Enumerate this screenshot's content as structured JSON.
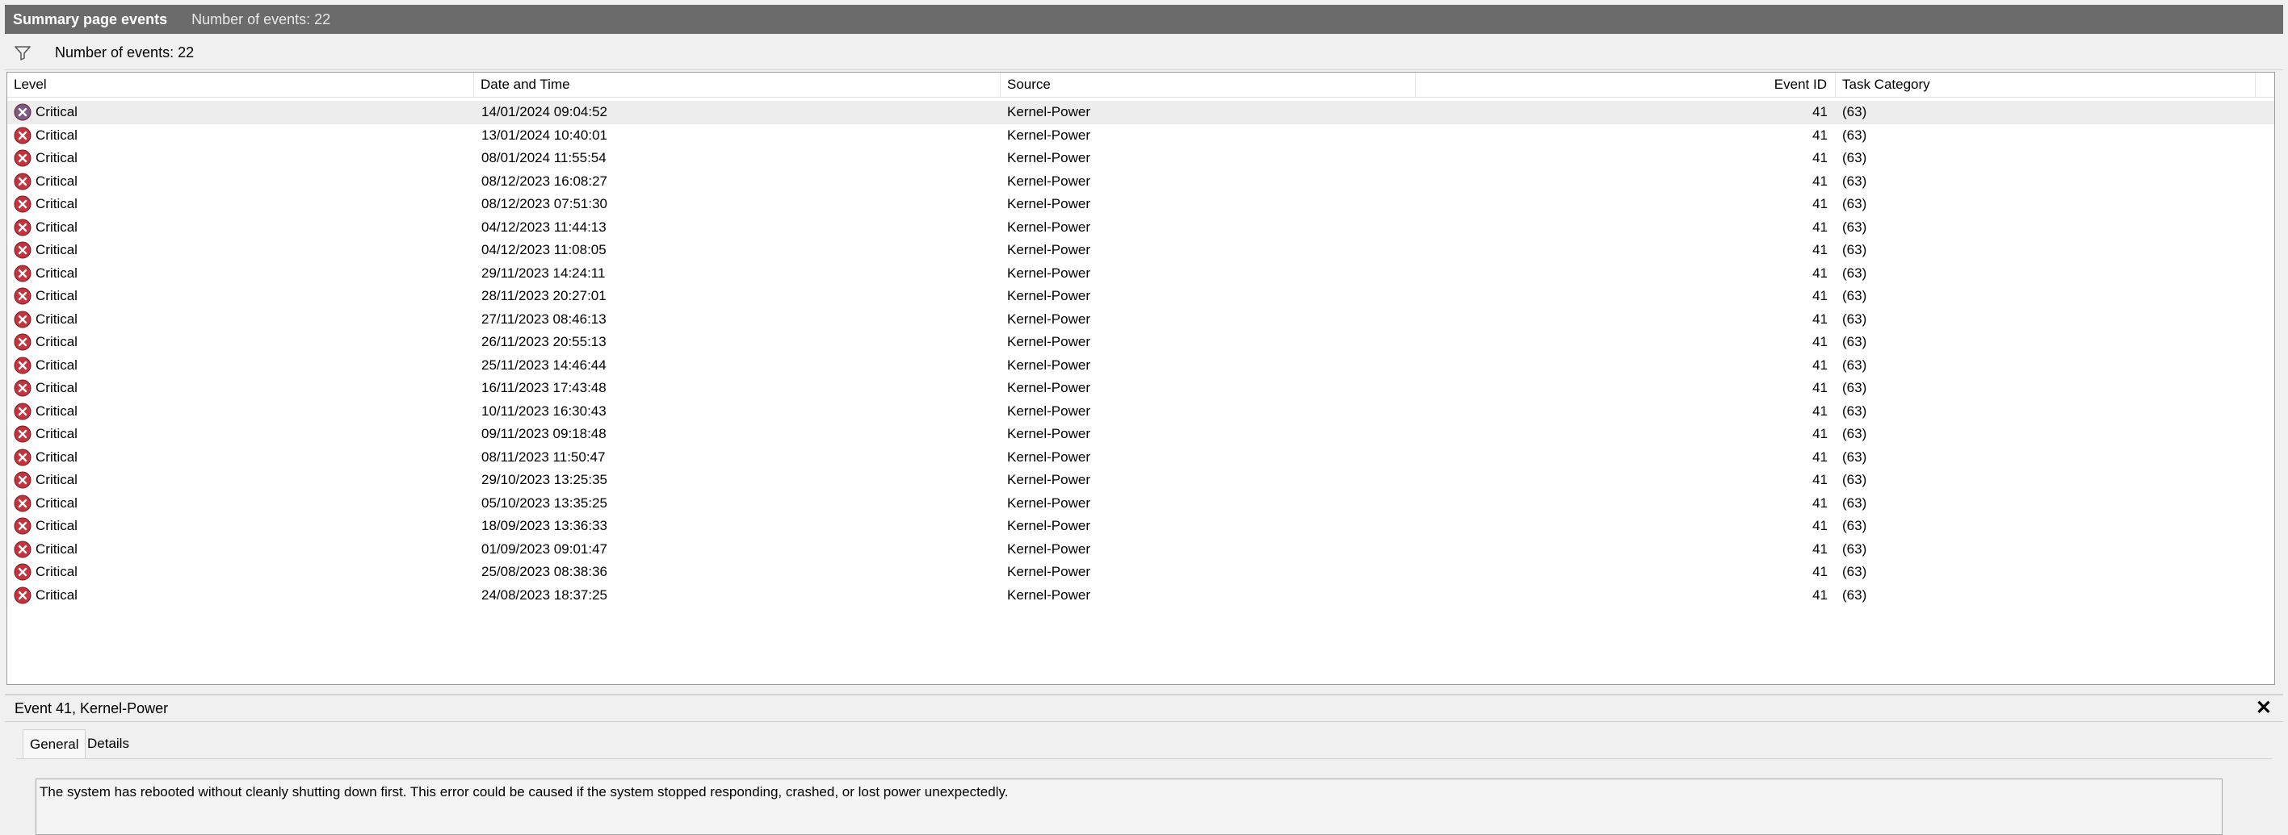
{
  "titlebar": {
    "title": "Summary page events",
    "count_text": "Number of events: 22"
  },
  "filter": {
    "icon": "filter-icon",
    "count_text": "Number of events: 22"
  },
  "columns": {
    "level": "Level",
    "datetime": "Date and Time",
    "source": "Source",
    "event_id": "Event ID",
    "task_category": "Task Category"
  },
  "events": [
    {
      "level": "Critical",
      "datetime": "14/01/2024 09:04:52",
      "source": "Kernel-Power",
      "event_id": "41",
      "task_category": "(63)"
    },
    {
      "level": "Critical",
      "datetime": "13/01/2024 10:40:01",
      "source": "Kernel-Power",
      "event_id": "41",
      "task_category": "(63)"
    },
    {
      "level": "Critical",
      "datetime": "08/01/2024 11:55:54",
      "source": "Kernel-Power",
      "event_id": "41",
      "task_category": "(63)"
    },
    {
      "level": "Critical",
      "datetime": "08/12/2023 16:08:27",
      "source": "Kernel-Power",
      "event_id": "41",
      "task_category": "(63)"
    },
    {
      "level": "Critical",
      "datetime": "08/12/2023 07:51:30",
      "source": "Kernel-Power",
      "event_id": "41",
      "task_category": "(63)"
    },
    {
      "level": "Critical",
      "datetime": "04/12/2023 11:44:13",
      "source": "Kernel-Power",
      "event_id": "41",
      "task_category": "(63)"
    },
    {
      "level": "Critical",
      "datetime": "04/12/2023 11:08:05",
      "source": "Kernel-Power",
      "event_id": "41",
      "task_category": "(63)"
    },
    {
      "level": "Critical",
      "datetime": "29/11/2023 14:24:11",
      "source": "Kernel-Power",
      "event_id": "41",
      "task_category": "(63)"
    },
    {
      "level": "Critical",
      "datetime": "28/11/2023 20:27:01",
      "source": "Kernel-Power",
      "event_id": "41",
      "task_category": "(63)"
    },
    {
      "level": "Critical",
      "datetime": "27/11/2023 08:46:13",
      "source": "Kernel-Power",
      "event_id": "41",
      "task_category": "(63)"
    },
    {
      "level": "Critical",
      "datetime": "26/11/2023 20:55:13",
      "source": "Kernel-Power",
      "event_id": "41",
      "task_category": "(63)"
    },
    {
      "level": "Critical",
      "datetime": "25/11/2023 14:46:44",
      "source": "Kernel-Power",
      "event_id": "41",
      "task_category": "(63)"
    },
    {
      "level": "Critical",
      "datetime": "16/11/2023 17:43:48",
      "source": "Kernel-Power",
      "event_id": "41",
      "task_category": "(63)"
    },
    {
      "level": "Critical",
      "datetime": "10/11/2023 16:30:43",
      "source": "Kernel-Power",
      "event_id": "41",
      "task_category": "(63)"
    },
    {
      "level": "Critical",
      "datetime": "09/11/2023 09:18:48",
      "source": "Kernel-Power",
      "event_id": "41",
      "task_category": "(63)"
    },
    {
      "level": "Critical",
      "datetime": "08/11/2023 11:50:47",
      "source": "Kernel-Power",
      "event_id": "41",
      "task_category": "(63)"
    },
    {
      "level": "Critical",
      "datetime": "29/10/2023 13:25:35",
      "source": "Kernel-Power",
      "event_id": "41",
      "task_category": "(63)"
    },
    {
      "level": "Critical",
      "datetime": "05/10/2023 13:35:25",
      "source": "Kernel-Power",
      "event_id": "41",
      "task_category": "(63)"
    },
    {
      "level": "Critical",
      "datetime": "18/09/2023 13:36:33",
      "source": "Kernel-Power",
      "event_id": "41",
      "task_category": "(63)"
    },
    {
      "level": "Critical",
      "datetime": "01/09/2023 09:01:47",
      "source": "Kernel-Power",
      "event_id": "41",
      "task_category": "(63)"
    },
    {
      "level": "Critical",
      "datetime": "25/08/2023 08:38:36",
      "source": "Kernel-Power",
      "event_id": "41",
      "task_category": "(63)"
    },
    {
      "level": "Critical",
      "datetime": "24/08/2023 18:37:25",
      "source": "Kernel-Power",
      "event_id": "41",
      "task_category": "(63)"
    }
  ],
  "selected_index": 0,
  "level_icon": "critical-error-icon",
  "colors": {
    "titlebar": "#6b6b6b",
    "critical": "#c8323c",
    "selected_row": "#ededed"
  },
  "detail": {
    "title": "Event 41, Kernel-Power",
    "close_icon": "close-icon",
    "tabs": [
      "General",
      "Details"
    ],
    "active_tab": "General",
    "description": "The system has rebooted without cleanly shutting down first. This error could be caused if the system stopped responding, crashed, or lost power unexpectedly."
  }
}
